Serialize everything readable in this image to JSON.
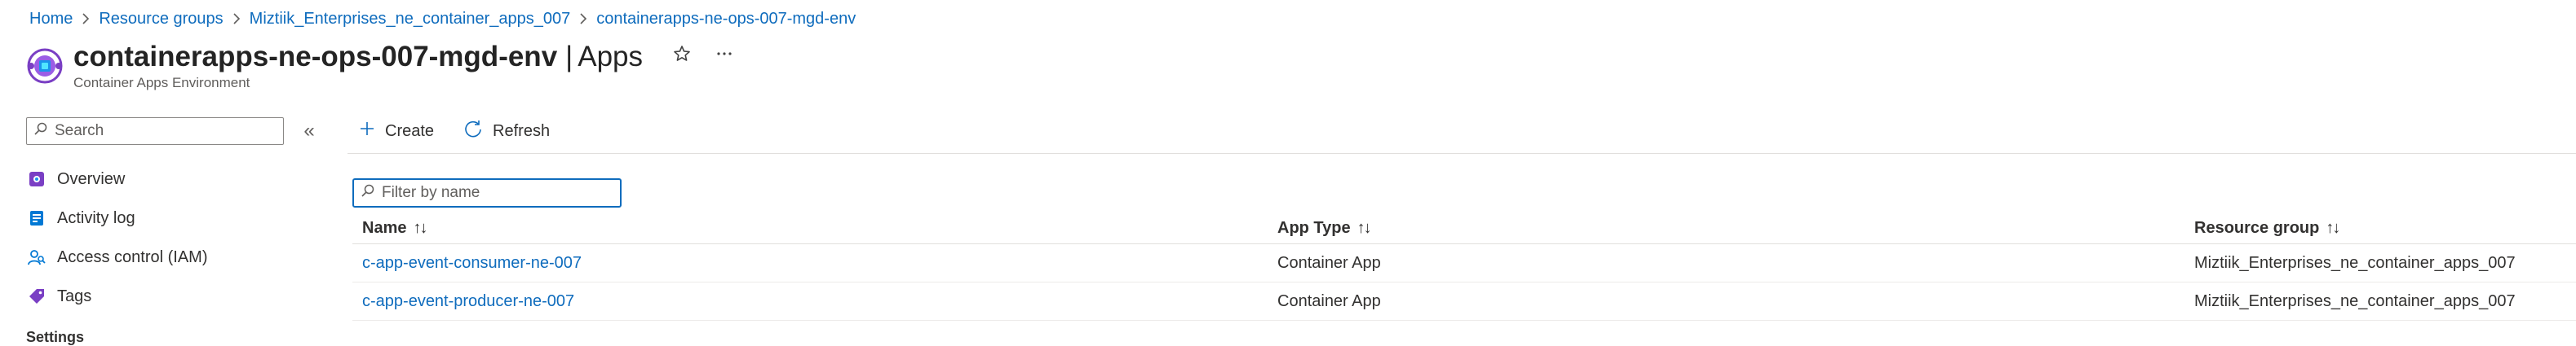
{
  "breadcrumb": [
    {
      "label": "Home"
    },
    {
      "label": "Resource groups"
    },
    {
      "label": "Miztiik_Enterprises_ne_container_apps_007"
    },
    {
      "label": "containerapps-ne-ops-007-mgd-env"
    }
  ],
  "header": {
    "resource_name": "containerapps-ne-ops-007-mgd-env",
    "separator": "|",
    "pane_title": "Apps",
    "resource_type": "Container Apps Environment",
    "favorite_icon": "star-icon",
    "more_icon": "ellipsis-icon"
  },
  "sidebar": {
    "search_placeholder": "Search",
    "collapse_glyph": "«",
    "items": [
      {
        "label": "Overview",
        "icon": "overview-icon"
      },
      {
        "label": "Activity log",
        "icon": "activity-log-icon"
      },
      {
        "label": "Access control (IAM)",
        "icon": "iam-icon"
      },
      {
        "label": "Tags",
        "icon": "tag-icon"
      }
    ],
    "section_label": "Settings"
  },
  "toolbar": {
    "create_label": "Create",
    "refresh_label": "Refresh"
  },
  "filter": {
    "placeholder": "Filter by name"
  },
  "grid": {
    "columns": [
      "Name",
      "App Type",
      "Resource group"
    ],
    "sort_glyph": "↑↓",
    "rows": [
      {
        "name": "c-app-event-consumer-ne-007",
        "type": "Container App",
        "resource_group": "Miztiik_Enterprises_ne_container_apps_007"
      },
      {
        "name": "c-app-event-producer-ne-007",
        "type": "Container App",
        "resource_group": "Miztiik_Enterprises_ne_container_apps_007"
      }
    ]
  },
  "colors": {
    "link": "#0f6cbd",
    "text": "#323130",
    "border": "#e1dfdd",
    "accent_purple": "#7a3fc4"
  }
}
